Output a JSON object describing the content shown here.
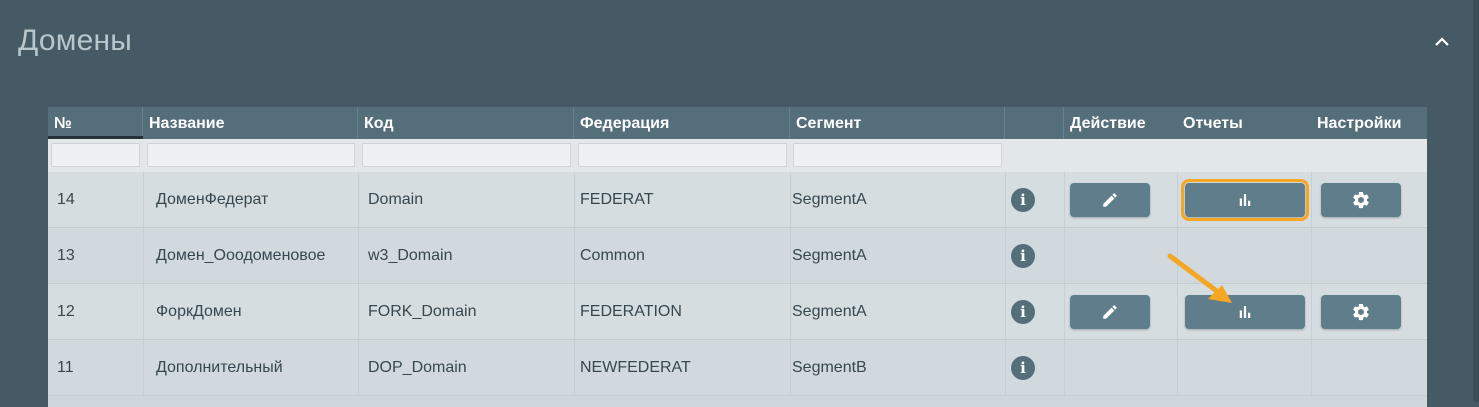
{
  "panel": {
    "title": "Домены",
    "collapse_icon": "chevron-up-icon"
  },
  "table": {
    "columns": [
      "№",
      "Название",
      "Код",
      "Федерация",
      "Сегмент",
      "",
      "Действие",
      "Отчеты",
      "Настройки"
    ],
    "rows": [
      {
        "num": "14",
        "name": "ДоменФедерат",
        "code": "Domain",
        "federation": "FEDERAT",
        "segment": "SegmentA",
        "has_actions": true
      },
      {
        "num": "13",
        "name": "Домен_Ооодоменовое",
        "code": "w3_Domain",
        "federation": "Common",
        "segment": "SegmentA",
        "has_actions": false
      },
      {
        "num": "12",
        "name": "ФоркДомен",
        "code": "FORK_Domain",
        "federation": "FEDERATION",
        "segment": "SegmentA",
        "has_actions": true
      },
      {
        "num": "11",
        "name": "Дополнительный",
        "code": "DOP_Domain",
        "federation": "NEWFEDERAT",
        "segment": "SegmentB",
        "has_actions": false
      }
    ],
    "icons": {
      "info": "info-icon",
      "edit": "pencil-icon",
      "reports": "bar-chart-icon",
      "settings": "gear-icon"
    }
  },
  "annotation": {
    "highlight_color": "#f5a623",
    "highlighted": "reports-button row 14"
  },
  "colors": {
    "background": "#455a64",
    "header": "#546e7a",
    "button": "#607d8b"
  }
}
